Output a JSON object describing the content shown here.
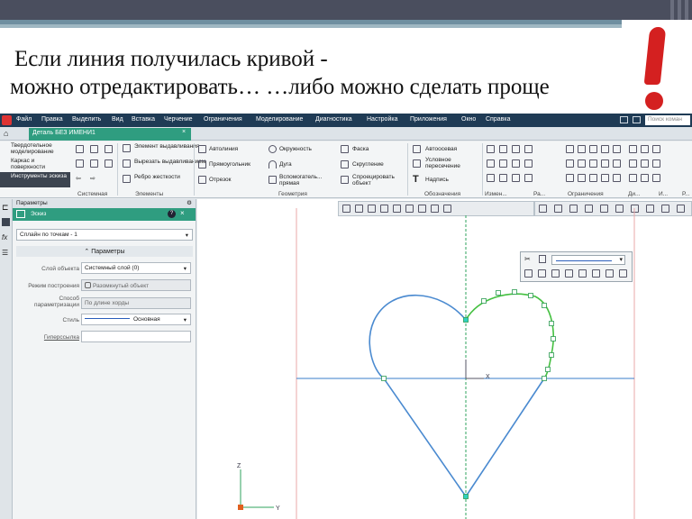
{
  "slide": {
    "line1": "Если линия получилась кривой -",
    "line2": " можно отредактировать…   …либо можно сделать проще",
    "exclamation_color": "#d42020"
  },
  "menu": {
    "items": [
      "Файл",
      "Правка",
      "Выделить",
      "Вид",
      "Вставка",
      "Черчение",
      "Ограничения",
      "Моделирование",
      "Диагностика",
      "Настройка",
      "Приложения",
      "Окно",
      "Справка"
    ],
    "search_placeholder": "Поиск коман"
  },
  "document_tab": "Деталь БЕЗ ИМЕНИ1",
  "modes": [
    {
      "label": "Твердотельное моделирование"
    },
    {
      "label": "Каркас и поверхности"
    },
    {
      "label": "Инструменты эскиза"
    }
  ],
  "ribbon": {
    "elements_buttons": [
      "Элемент выдавливания",
      "Вырезать выдавливанием",
      "Ребро жесткости"
    ],
    "geometry_col1": [
      "Автолиния",
      "Прямоугольник",
      "Отрезок"
    ],
    "geometry_col2": [
      "Окружность",
      "Дуга",
      "Вспомогатель... прямая"
    ],
    "geometry_col3": [
      "Фаска",
      "Скругление",
      "Спроецировать объект"
    ],
    "notation_col": [
      "Автоосевая",
      "Условное пересечение",
      "Надпись"
    ],
    "groups": [
      "Системная",
      "Элементы",
      "Геометрия",
      "Обозначения",
      "Измен...",
      "Ра...",
      "Ограничения",
      "Ди...",
      "И...",
      "Р..."
    ]
  },
  "panel": {
    "title": "Параметры",
    "mode": "Эскиз",
    "command": "Сплайн по точкам - 1",
    "section": "Параметры",
    "rows": [
      {
        "label": "Слой объекта",
        "value": "Системный слой (0)"
      },
      {
        "label": "Режим построения",
        "value": "Разомкнутый объект"
      },
      {
        "label": "Способ параметризации",
        "value": "По длине хорды"
      },
      {
        "label": "Стиль",
        "value": "Основная"
      },
      {
        "label": "Гиперссылка",
        "value": ""
      }
    ]
  },
  "canvas": {
    "axis_x_label": "X",
    "axis_y_label": "Y",
    "axis_z_label": "Z",
    "curve_color": "#4a8ad0",
    "edit_color": "#44c040",
    "axis_color": "#2fa35e"
  }
}
